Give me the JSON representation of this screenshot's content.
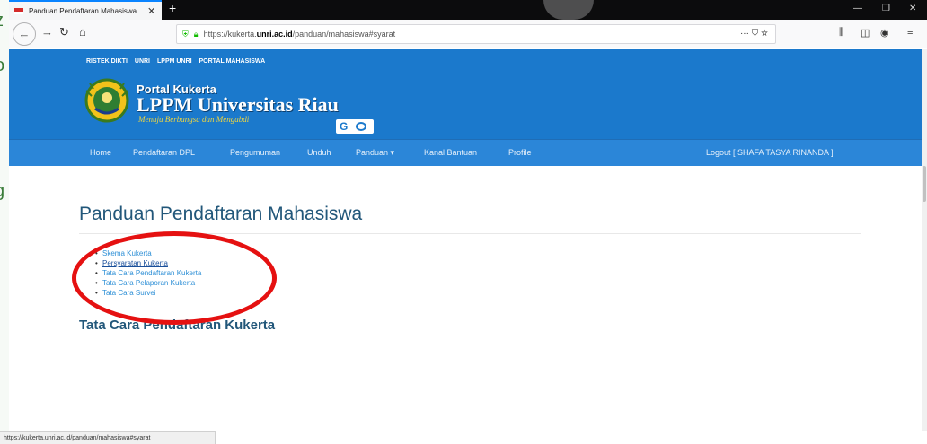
{
  "tab": {
    "title": "Panduan Pendaftaran Mahasiswa"
  },
  "urlbar": {
    "prefix": "https://kukerta.",
    "host": "unri.ac.id",
    "path": "/panduan/mahasiswa#syarat"
  },
  "header": {
    "top_links": [
      "RISTEK DIKTI",
      "UNRI",
      "LPPM UNRI",
      "PORTAL MAHASISWA"
    ],
    "brand_small": "Portal Kukerta",
    "brand_big": "LPPM Universitas Riau",
    "motto": "Menuju Berbangsa dan Mengabdi"
  },
  "nav": {
    "items": [
      {
        "label": "Home"
      },
      {
        "label": "Pendaftaran DPL"
      },
      {
        "label": "Pengumuman"
      },
      {
        "label": "Unduh"
      },
      {
        "label": "Panduan ▾"
      },
      {
        "label": "Kanal Bantuan"
      },
      {
        "label": "Profile"
      }
    ],
    "logout": "Logout [ SHAFA TASYA RINANDA ]"
  },
  "content": {
    "title": "Panduan Pendaftaran Mahasiswa",
    "links": [
      {
        "label": "Skema Kukerta"
      },
      {
        "label": "Persyaratan Kukerta"
      },
      {
        "label": "Tata Cara Pendaftaran Kukerta"
      },
      {
        "label": "Tata Cara Pelaporan Kukerta"
      },
      {
        "label": "Tata Cara Survei"
      }
    ],
    "section_title": "Tata Cara Pendaftaran Kukerta"
  },
  "status": {
    "url": "https://kukerta.unri.ac.id/panduan/mahasiswa#syarat"
  },
  "colors": {
    "header_blue": "#1b79cc",
    "nav_blue": "#2b86d8",
    "link": "#2d8fd6",
    "title": "#22577a",
    "highlight_red": "#e51111"
  }
}
